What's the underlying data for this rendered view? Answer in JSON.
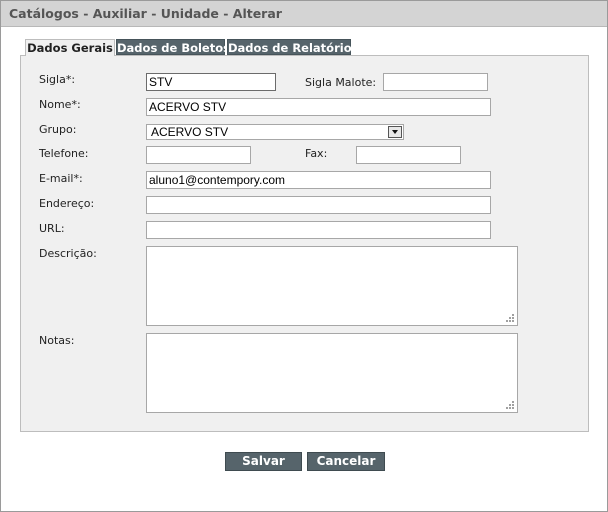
{
  "window": {
    "title": "Catálogos - Auxiliar - Unidade - Alterar"
  },
  "tabs": [
    {
      "label": "Dados Gerais",
      "active": true
    },
    {
      "label": "Dados de Boletos",
      "active": false
    },
    {
      "label": "Dados de Relatórios",
      "active": false
    }
  ],
  "form": {
    "sigla": {
      "label": "Sigla*:",
      "value": "STV"
    },
    "sigla_malote": {
      "label": "Sigla Malote:",
      "value": ""
    },
    "nome": {
      "label": "Nome*:",
      "value": "ACERVO STV"
    },
    "grupo": {
      "label": "Grupo:",
      "selected": "ACERVO STV"
    },
    "telefone": {
      "label": "Telefone:",
      "value": ""
    },
    "fax": {
      "label": "Fax:",
      "value": ""
    },
    "email": {
      "label": "E-mail*:",
      "value": "aluno1@contempory.com"
    },
    "endereco": {
      "label": "Endereço:",
      "value": ""
    },
    "url": {
      "label": "URL:",
      "value": ""
    },
    "descricao": {
      "label": "Descrição:",
      "value": ""
    },
    "notas": {
      "label": "Notas:",
      "value": ""
    }
  },
  "buttons": {
    "save": "Salvar",
    "cancel": "Cancelar"
  },
  "colors": {
    "title_bar": "#d4d4d4",
    "panel_bg": "#f0f0f0",
    "button_bg": "#56646b",
    "inactive_tab_bg": "#56646b"
  }
}
